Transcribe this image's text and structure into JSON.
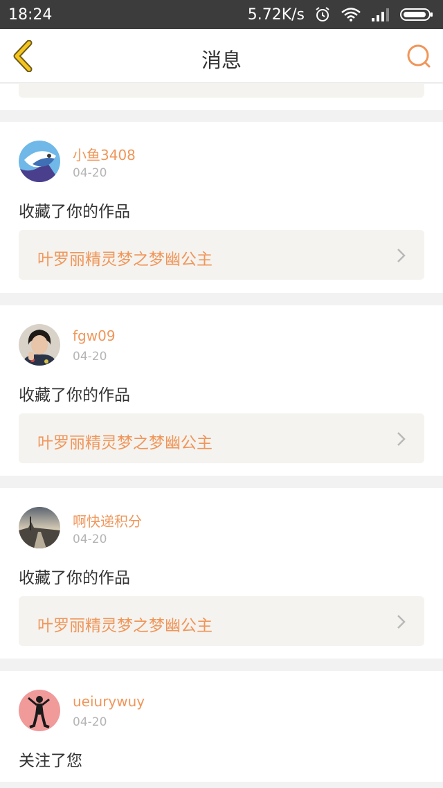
{
  "status_bar": {
    "time": "18:24",
    "net_speed": "5.72K/s",
    "icons": [
      "alarm-icon",
      "wifi-icon",
      "signal-icon",
      "battery-icon"
    ]
  },
  "header": {
    "title": "消息",
    "back_icon": "chevron-left-icon",
    "search_icon": "search-icon"
  },
  "colors": {
    "accent": "#f0965a",
    "back_arrow": "#f5c51e",
    "card_link_bg": "#f4f3ef",
    "status_bar": "#3c3c3c"
  },
  "messages": [
    {
      "username": "小鱼3408",
      "date": "04-20",
      "action": "收藏了你的作品",
      "work_title": "叶罗丽精灵梦之梦幽公主"
    },
    {
      "username": "fgw09",
      "date": "04-20",
      "action": "收藏了你的作品",
      "work_title": "叶罗丽精灵梦之梦幽公主"
    },
    {
      "username": "啊快递积分",
      "date": "04-20",
      "action": "收藏了你的作品",
      "work_title": "叶罗丽精灵梦之梦幽公主"
    },
    {
      "username": "ueiurywuy",
      "date": "04-20",
      "action": "关注了您"
    }
  ]
}
